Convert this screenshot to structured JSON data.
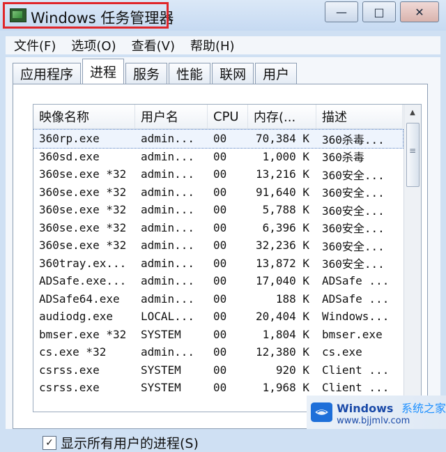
{
  "window": {
    "title": "Windows 任务管理器",
    "controls": {
      "minimize": "—",
      "maximize": "□",
      "close": "✕"
    }
  },
  "menu": [
    "文件(F)",
    "选项(O)",
    "查看(V)",
    "帮助(H)"
  ],
  "tabs": [
    {
      "label": "应用程序",
      "active": false
    },
    {
      "label": "进程",
      "active": true
    },
    {
      "label": "服务",
      "active": false
    },
    {
      "label": "性能",
      "active": false
    },
    {
      "label": "联网",
      "active": false
    },
    {
      "label": "用户",
      "active": false
    }
  ],
  "process_table": {
    "columns": [
      "映像名称",
      "用户名",
      "CPU",
      "内存(...",
      "描述"
    ],
    "rows": [
      [
        "360rp.exe",
        "admin...",
        "00",
        "70,384 K",
        "360杀毒..."
      ],
      [
        "360sd.exe",
        "admin...",
        "00",
        "1,000 K",
        "360杀毒"
      ],
      [
        "360se.exe *32",
        "admin...",
        "00",
        "13,216 K",
        "360安全..."
      ],
      [
        "360se.exe *32",
        "admin...",
        "00",
        "91,640 K",
        "360安全..."
      ],
      [
        "360se.exe *32",
        "admin...",
        "00",
        "5,788 K",
        "360安全..."
      ],
      [
        "360se.exe *32",
        "admin...",
        "00",
        "6,396 K",
        "360安全..."
      ],
      [
        "360se.exe *32",
        "admin...",
        "00",
        "32,236 K",
        "360安全..."
      ],
      [
        "360tray.ex...",
        "admin...",
        "00",
        "13,872 K",
        "360安全..."
      ],
      [
        "ADSafe.exe...",
        "admin...",
        "00",
        "17,040 K",
        "ADSafe ..."
      ],
      [
        "ADSafe64.exe",
        "admin...",
        "00",
        "188 K",
        "ADSafe ..."
      ],
      [
        "audiodg.exe",
        "LOCAL...",
        "00",
        "20,404 K",
        "Windows..."
      ],
      [
        "bmser.exe *32",
        "SYSTEM",
        "00",
        "1,804 K",
        "bmser.exe"
      ],
      [
        "cs.exe *32",
        "admin...",
        "00",
        "12,380 K",
        "cs.exe"
      ],
      [
        "csrss.exe",
        "SYSTEM",
        "00",
        "920 K",
        "Client ..."
      ],
      [
        "csrss.exe",
        "SYSTEM",
        "00",
        "1,968 K",
        "Client ..."
      ]
    ],
    "selected_row": 0
  },
  "show_all_users": {
    "label": "显示所有用户的进程(S)",
    "checked": true
  },
  "watermark": {
    "brand": "Windows",
    "brand_cn": "系统之家",
    "url": "www.bjjmlv.com"
  }
}
